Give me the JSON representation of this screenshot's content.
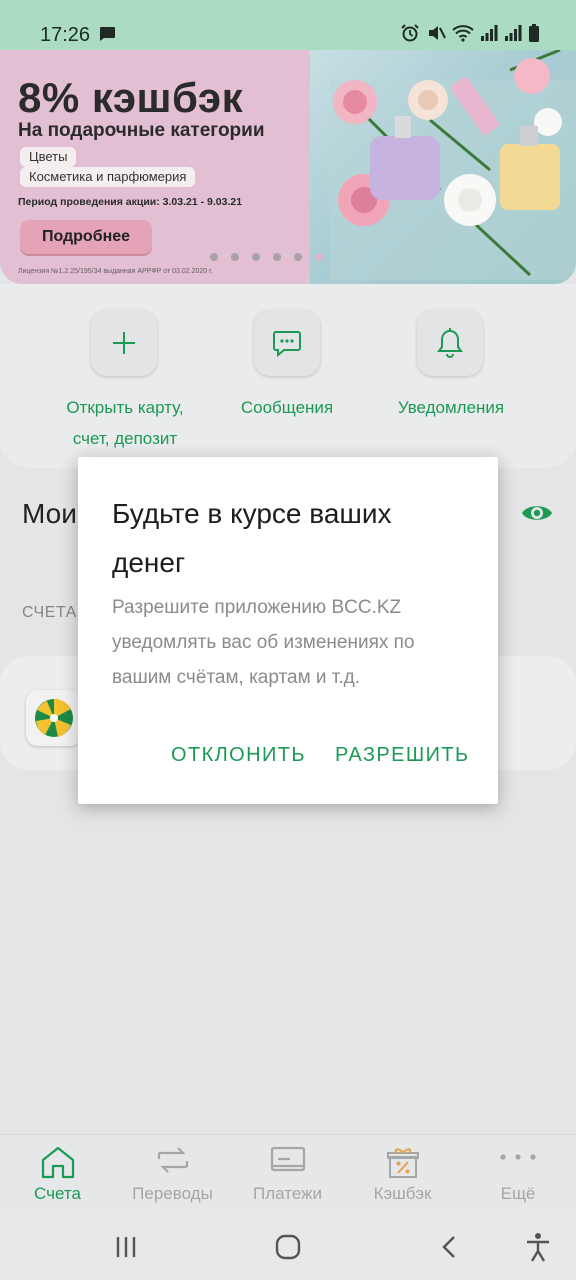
{
  "status_bar": {
    "time": "17:26"
  },
  "banner": {
    "title": "8% кэшбэк",
    "subtitle": "На подарочные категории",
    "tags": [
      "Цветы",
      "Косметика и парфюмерия"
    ],
    "period": "Период проведения акции: 3.03.21 - 9.03.21",
    "button": "Подробнее",
    "license": "Лицензия №1.2.25/195/34 выданная АРРФР от 03.02.2020 г.",
    "pages": 6,
    "active_page": 5
  },
  "quick_actions": [
    {
      "label": "Открыть карту,\nсчет, депозит",
      "icon": "plus-icon"
    },
    {
      "label": "Сообщения",
      "icon": "chat-icon"
    },
    {
      "label": "Уведомления",
      "icon": "bell-icon"
    }
  ],
  "main": {
    "section_title": "Мои",
    "section_label": "СЧЕТА"
  },
  "dialog": {
    "title": "Будьте в курсе ваших денег",
    "body": "Разрешите приложению BCC.KZ уведомлять вас об изменениях по вашим счётам, картам и т.д.",
    "decline": "ОТКЛОНИТЬ",
    "allow": "РАЗРЕШИТЬ"
  },
  "bottom_nav": [
    {
      "label": "Счета",
      "icon": "home-icon",
      "active": true
    },
    {
      "label": "Переводы",
      "icon": "transfer-icon",
      "active": false
    },
    {
      "label": "Платежи",
      "icon": "payment-icon",
      "active": false
    },
    {
      "label": "Кэшбэк",
      "icon": "gift-icon",
      "active": false
    },
    {
      "label": "Ещё",
      "icon": "more-icon",
      "active": false
    }
  ],
  "colors": {
    "accent": "#1b9a55",
    "status_bar": "#abdcc2",
    "banner_bg": "#e2bfd2",
    "button_pink": "#e4a3b6"
  }
}
